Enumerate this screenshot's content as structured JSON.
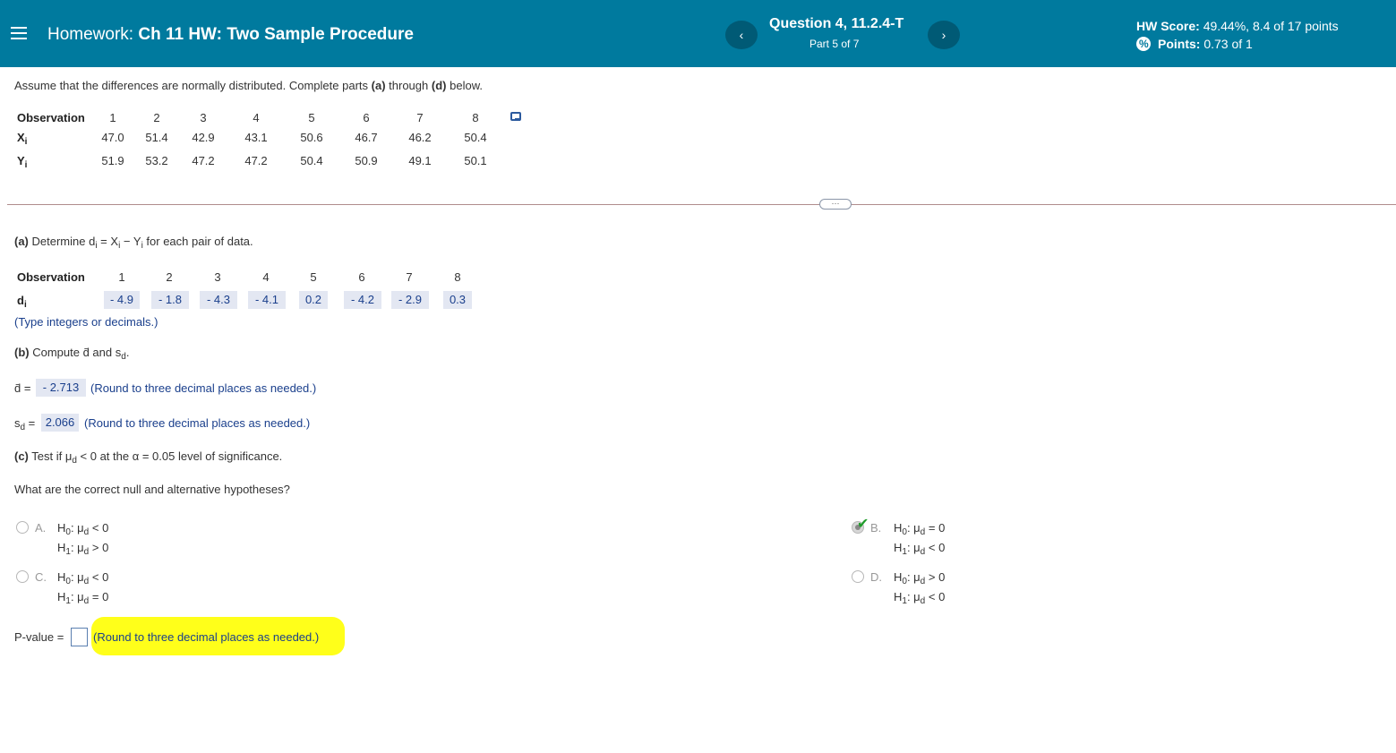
{
  "header": {
    "homework_prefix": "Homework:",
    "homework_name": "Ch 11 HW: Two Sample Procedure",
    "question_title": "Question 4, 11.2.4-T",
    "question_part": "Part 5 of 7",
    "prev": "‹",
    "next": "›",
    "score_label": "HW Score:",
    "score_value": "49.44%, 8.4 of 17 points",
    "points_label": "Points:",
    "points_value": "0.73 of 1"
  },
  "intro": "Assume that the differences are normally distributed. Complete parts",
  "intro_a": "(a)",
  "intro_through": "through",
  "intro_d": "(d)",
  "intro_end": "below.",
  "table1": {
    "obs_label": "Observation",
    "x_label": "X",
    "x_sub": "i",
    "y_label": "Y",
    "y_sub": "i",
    "obs": [
      "1",
      "2",
      "3",
      "4",
      "5",
      "6",
      "7",
      "8"
    ],
    "x": [
      "47.0",
      "51.4",
      "42.9",
      "43.1",
      "50.6",
      "46.7",
      "46.2",
      "50.4"
    ],
    "y": [
      "51.9",
      "53.2",
      "47.2",
      "47.2",
      "50.4",
      "50.9",
      "49.1",
      "50.1"
    ]
  },
  "more_button": "···",
  "part_a": {
    "label": "(a)",
    "text1": "Determine d",
    "sub_i": "i",
    "text2": " = X",
    "text3": " − Y",
    "text4": " for each pair of data.",
    "obs_label": "Observation",
    "d_label": "d",
    "d_sub": "i",
    "obs": [
      "1",
      "2",
      "3",
      "4",
      "5",
      "6",
      "7",
      "8"
    ],
    "d": [
      "- 4.9",
      "- 1.8",
      "- 4.3",
      "- 4.1",
      "0.2",
      "- 4.2",
      "- 2.9",
      "0.3"
    ],
    "hint": "(Type integers or decimals.)"
  },
  "part_b": {
    "label": "(b)",
    "text": "Compute d̄ and s",
    "text_sub": "d",
    "text_end": ".",
    "dbar_label": "d̄ =",
    "dbar_value": "- 2.713",
    "dbar_hint": "(Round to three decimal places as needed.)",
    "sd_label": "s",
    "sd_sub": "d",
    "sd_eq": " =",
    "sd_value": "2.066",
    "sd_hint": "(Round to three decimal places as needed.)"
  },
  "part_c": {
    "label": "(c)",
    "text1": "Test if μ",
    "sub": "d",
    "text2": " < 0 at the α = 0.05 level of significance.",
    "question": "What are the correct null and alternative hypotheses?"
  },
  "options": {
    "A": {
      "letter": "A.",
      "h0": "< 0",
      "h1": "> 0"
    },
    "B": {
      "letter": "B.",
      "h0": "= 0",
      "h1": "< 0"
    },
    "C": {
      "letter": "C.",
      "h0": "< 0",
      "h1": "= 0"
    },
    "D": {
      "letter": "D.",
      "h0": "> 0",
      "h1": "< 0"
    },
    "h0_prefix": "H",
    "h0_sub": "0",
    "h1_prefix": "H",
    "h1_sub": "1",
    "mu": ": μ",
    "mu_sub": "d"
  },
  "pvalue": {
    "label": "P-value =",
    "value": "",
    "hint": "(Round to three decimal places as needed.)"
  },
  "colors": {
    "header_bg": "#007a9e",
    "answer_bg": "#e3e7f2",
    "answer_text": "#1a3f8c",
    "highlight": "#ffff1a",
    "check": "#1f9c2a"
  }
}
